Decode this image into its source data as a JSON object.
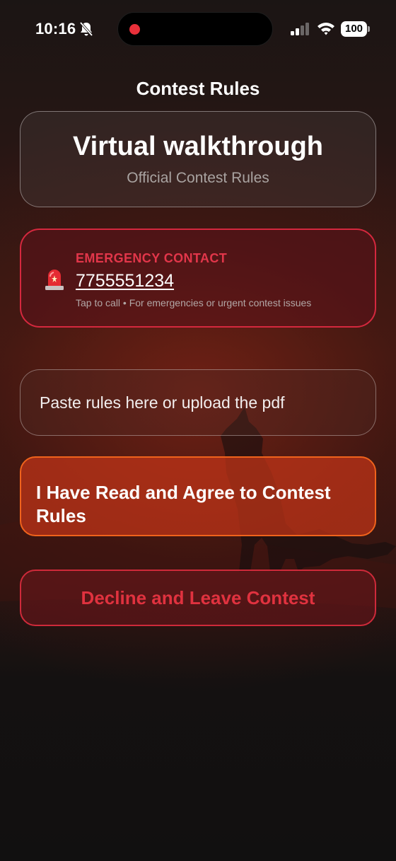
{
  "status_bar": {
    "time": "10:16",
    "battery": "100",
    "icons": [
      "bell-slash-icon",
      "recording-dot-icon",
      "cellular-signal-icon",
      "wifi-icon",
      "battery-icon"
    ]
  },
  "header": {
    "title": "Contest Rules"
  },
  "contest": {
    "name": "Virtual walkthrough",
    "subtitle": "Official Contest Rules"
  },
  "emergency": {
    "label": "EMERGENCY CONTACT",
    "phone": "7755551234",
    "note": "Tap to call • For emergencies or urgent contest issues",
    "icon": "siren-icon"
  },
  "rules_input": {
    "value": "",
    "placeholder": "Paste rules here or upload the pdf"
  },
  "actions": {
    "agree_label": "I Have Read and Agree to Contest Rules",
    "decline_label": "Decline and Leave Contest"
  },
  "colors": {
    "emergency_red": "#d5283e",
    "agree_orange": "#f0631c",
    "decline_red": "#cf2a3a"
  }
}
